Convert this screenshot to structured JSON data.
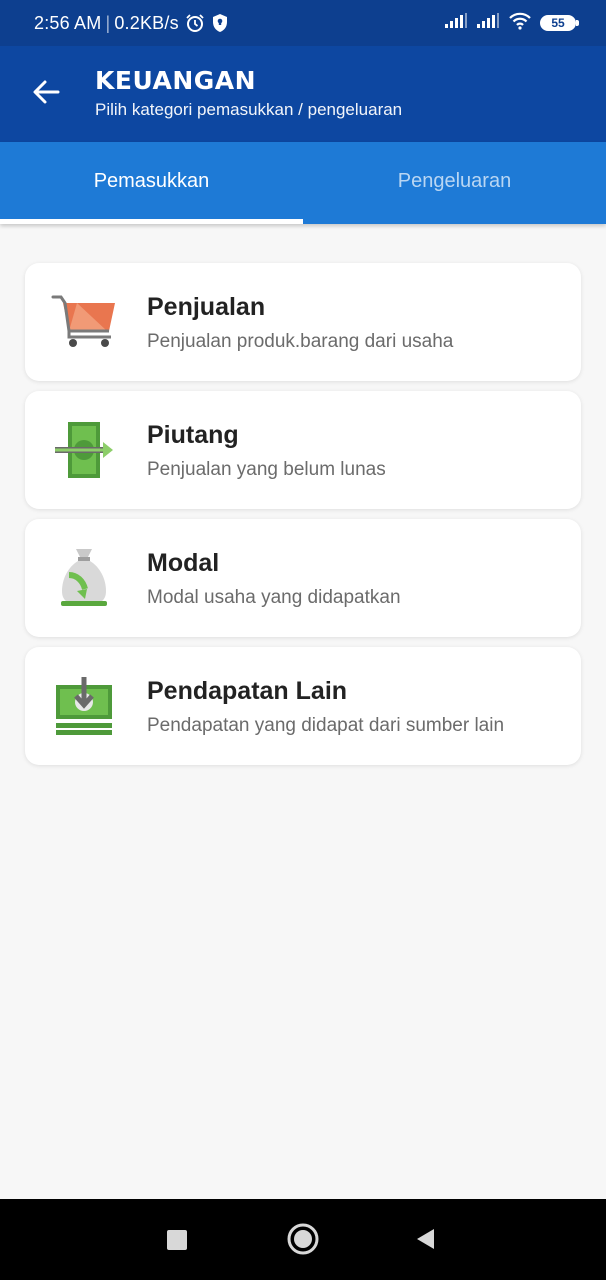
{
  "status_bar": {
    "time": "2:56 AM",
    "net_speed": "0.2KB/s",
    "battery": "55",
    "icons": [
      "alarm-icon",
      "shield-icon",
      "signal-icon",
      "signal-icon",
      "wifi-icon",
      "battery-icon"
    ]
  },
  "app_bar": {
    "title": "KEUANGAN",
    "subtitle": "Pilih kategori pemasukkan / pengeluaran",
    "back_icon": "arrow-left-icon"
  },
  "tabs": [
    {
      "label": "Pemasukkan",
      "active": true
    },
    {
      "label": "Pengeluaran",
      "active": false
    }
  ],
  "categories": [
    {
      "title": "Penjualan",
      "desc": "Penjualan produk.barang dari usaha",
      "icon": "shopping-cart-icon"
    },
    {
      "title": "Piutang",
      "desc": "Penjualan yang belum lunas",
      "icon": "money-transfer-icon"
    },
    {
      "title": "Modal",
      "desc": "Modal usaha yang didapatkan",
      "icon": "money-bag-icon"
    },
    {
      "title": "Pendapatan Lain",
      "desc": "Pendapatan yang didapat dari sumber lain",
      "icon": "cash-deposit-icon"
    }
  ],
  "colors": {
    "status_bar": "#0d3f8f",
    "app_bar": "#0d47a1",
    "tabs": "#1e7ad6",
    "background": "#f7f7f7"
  },
  "nav_bar": {
    "icons": [
      "recents-square-icon",
      "home-circle-icon",
      "back-triangle-icon"
    ]
  }
}
